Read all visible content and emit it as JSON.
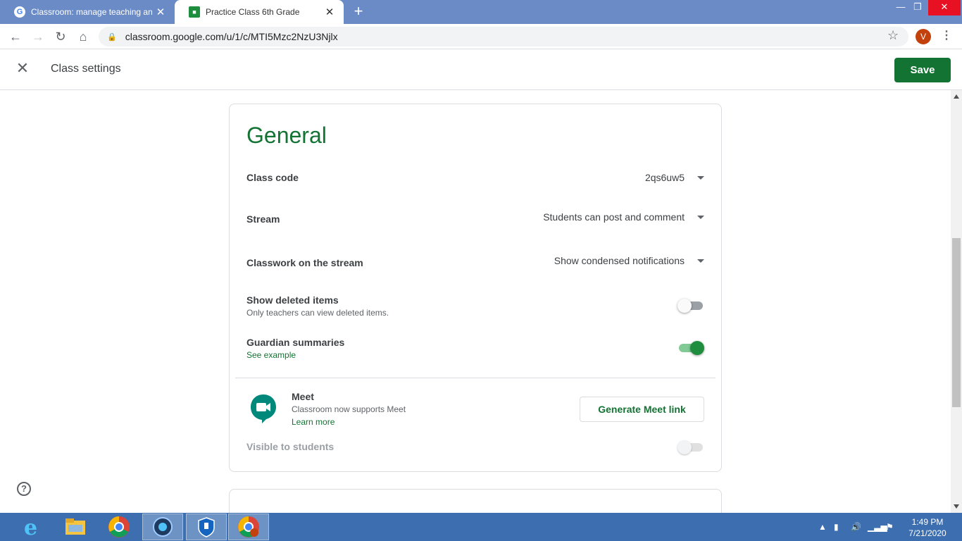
{
  "browser": {
    "tabs": [
      {
        "label": "Classroom: manage teaching and",
        "active": false
      },
      {
        "label": "Practice Class 6th Grade",
        "active": true
      }
    ],
    "new_tab_glyph": "+",
    "url": "classroom.google.com/u/1/c/MTI5Mzc2NzU3Njlx",
    "profile_initial": "V"
  },
  "header": {
    "title": "Class settings",
    "save_label": "Save"
  },
  "general": {
    "heading": "General",
    "class_code": {
      "label": "Class code",
      "value": "2qs6uw5"
    },
    "stream": {
      "label": "Stream",
      "value": "Students can post and comment"
    },
    "classwork": {
      "label": "Classwork on the stream",
      "value": "Show condensed notifications"
    },
    "deleted": {
      "label": "Show deleted items",
      "sub": "Only teachers can view deleted items.",
      "enabled": false
    },
    "guardian": {
      "label": "Guardian summaries",
      "link": "See example",
      "enabled": true
    },
    "meet": {
      "title": "Meet",
      "sub": "Classroom now supports Meet",
      "link": "Learn more",
      "button": "Generate Meet link",
      "visible_label": "Visible to students",
      "visible_enabled": false
    }
  },
  "taskbar": {
    "time": "1:49 PM",
    "date": "7/21/2020"
  },
  "colors": {
    "accent": "#137333",
    "tabstrip": "#6b8bc6",
    "taskbar": "#3d6fb0"
  }
}
